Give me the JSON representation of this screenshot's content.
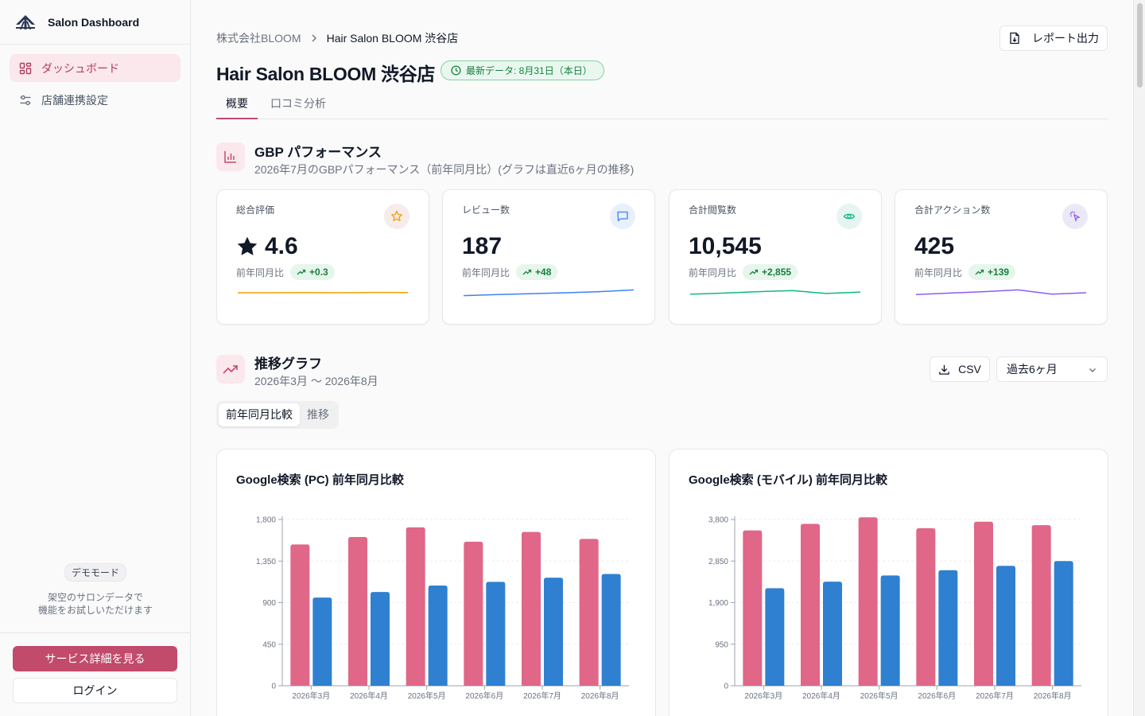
{
  "sidebar": {
    "app_name": "Salon Dashboard",
    "items": [
      {
        "label": "ダッシュボード",
        "icon": "dashboard-icon"
      },
      {
        "label": "店舗連携設定",
        "icon": "settings-sliders-icon"
      }
    ],
    "demo_badge": "デモモード",
    "demo_line1": "架空のサロンデータで",
    "demo_line2": "機能をお試しいただけます",
    "primary_button": "サービス詳細を見る",
    "login_button": "ログイン"
  },
  "header": {
    "breadcrumb": [
      "株式会社BLOOM",
      "Hair Salon BLOOM 渋谷店"
    ],
    "report_button": "レポート出力",
    "title": "Hair Salon BLOOM 渋谷店",
    "fresh_badge": "最新データ: 8月31日（本日）",
    "tabs": [
      "概要",
      "口コミ分析"
    ]
  },
  "gbp": {
    "title": "GBP パフォーマンス",
    "subtitle": "2026年7月のGBPパフォーマンス（前年同月比）(グラフは直近6ヶ月の推移)",
    "kpis": [
      {
        "label": "総合評価",
        "value": "4.6",
        "compare_label": "前年同月比",
        "delta": "+0.3",
        "icon": "star-icon",
        "color": "#f59e0b",
        "icon_bg": "#f6ece9",
        "spark": [
          0.5,
          0.5,
          0.49,
          0.5,
          0.48,
          0.49
        ]
      },
      {
        "label": "レビュー数",
        "value": "187",
        "compare_label": "前年同月比",
        "delta": "+48",
        "icon": "chat-icon",
        "color": "#3b82f6",
        "icon_bg": "#e8f0fb",
        "spark": [
          0.7,
          0.62,
          0.56,
          0.5,
          0.42,
          0.3
        ]
      },
      {
        "label": "合計閲覧数",
        "value": "10,545",
        "compare_label": "前年同月比",
        "delta": "+2,855",
        "icon": "eye-icon",
        "color": "#10b981",
        "icon_bg": "#e6f5f1",
        "spark": [
          0.6,
          0.52,
          0.42,
          0.35,
          0.55,
          0.45
        ]
      },
      {
        "label": "合計アクション数",
        "value": "425",
        "compare_label": "前年同月比",
        "delta": "+139",
        "icon": "sparkle-click-icon",
        "color": "#8b5cf6",
        "icon_bg": "#ece9f7",
        "spark": [
          0.62,
          0.52,
          0.42,
          0.3,
          0.6,
          0.5
        ]
      }
    ]
  },
  "trend": {
    "title": "推移グラフ",
    "subtitle": "2026年3月 〜 2026年8月",
    "csv_button": "CSV",
    "range_select": "過去6ヶ月",
    "segments": [
      "前年同月比較",
      "推移"
    ]
  },
  "colors": {
    "accent": "#c24a6b",
    "bar_prev": "#e06788",
    "bar_curr": "#2f80d1"
  },
  "chart_data": [
    {
      "type": "bar",
      "title": "Google検索 (PC) 前年同月比較",
      "categories": [
        "2026年3月",
        "2026年4月",
        "2026年5月",
        "2026年6月",
        "2026年7月",
        "2026年8月"
      ],
      "series": [
        {
          "values": [
            1530,
            1610,
            1715,
            1560,
            1665,
            1590
          ]
        },
        {
          "values": [
            955,
            1015,
            1085,
            1125,
            1170,
            1210
          ]
        }
      ],
      "yticks": [
        0,
        450,
        900,
        1350,
        1800
      ],
      "ytick_labels": [
        "0",
        "450",
        "900",
        "1,350",
        "1,800"
      ],
      "ylim": [
        0,
        1800
      ]
    },
    {
      "type": "bar",
      "title": "Google検索 (モバイル) 前年同月比較",
      "categories": [
        "2026年3月",
        "2026年4月",
        "2026年5月",
        "2026年6月",
        "2026年7月",
        "2026年8月"
      ],
      "series": [
        {
          "values": [
            3550,
            3700,
            3850,
            3600,
            3750,
            3670
          ]
        },
        {
          "values": [
            2230,
            2380,
            2520,
            2640,
            2740,
            2850
          ]
        }
      ],
      "yticks": [
        0,
        950,
        1900,
        2850,
        3800
      ],
      "ytick_labels": [
        "0",
        "950",
        "1,900",
        "2,850",
        "3,800"
      ],
      "ylim": [
        0,
        3800
      ]
    }
  ]
}
